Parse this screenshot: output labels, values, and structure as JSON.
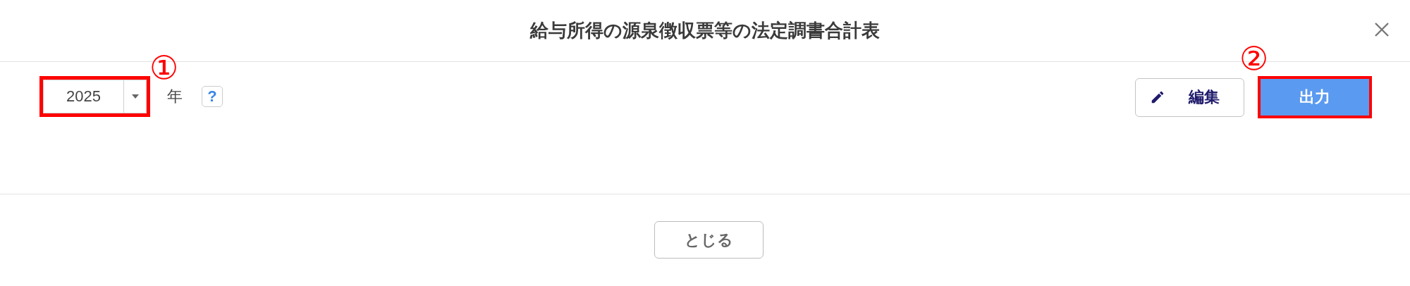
{
  "dialog": {
    "title": "給与所得の源泉徴収票等の法定調書合計表"
  },
  "year_select": {
    "value": "2025",
    "unit": "年",
    "help": "?",
    "annotation": "①"
  },
  "toolbar_buttons": [
    {
      "label": "編集",
      "kind": "edit"
    },
    {
      "label": "出力",
      "kind": "primary",
      "annotation": "②"
    }
  ],
  "footer_buttons": [
    "とじる"
  ]
}
